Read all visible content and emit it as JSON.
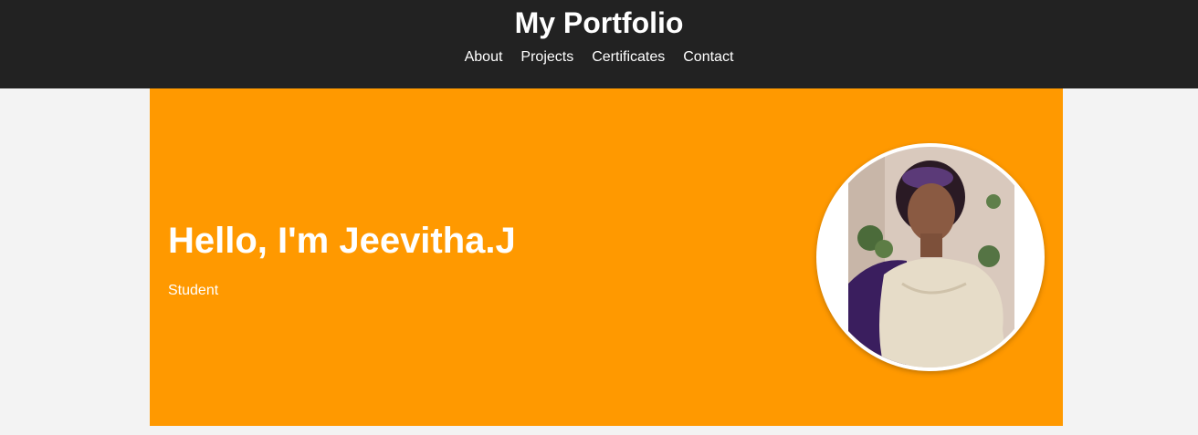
{
  "header": {
    "title": "My Portfolio",
    "nav": [
      "About",
      "Projects",
      "Certificates",
      "Contact"
    ]
  },
  "hero": {
    "heading": "Hello, I'm Jeevitha.J",
    "subtitle": "Student"
  },
  "colors": {
    "header_bg": "#222222",
    "hero_bg": "#ff9900",
    "page_bg": "#f3f3f3"
  }
}
